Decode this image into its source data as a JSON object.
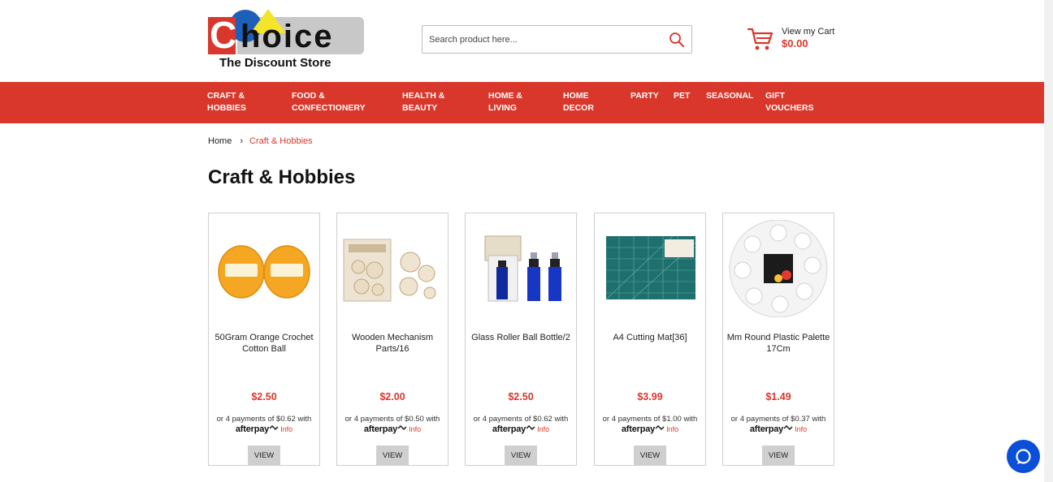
{
  "logo": {
    "wordmark_initial": "C",
    "wordmark_rest": "hoice",
    "tagline": "The Discount Store"
  },
  "search": {
    "placeholder": "Search product here..."
  },
  "cart": {
    "title": "View my Cart",
    "total": "$0.00"
  },
  "nav": [
    {
      "label": "CRAFT &\nHOBBIES"
    },
    {
      "label": "FOOD &\nCONFECTIONERY"
    },
    {
      "label": "HEALTH &\nBEAUTY"
    },
    {
      "label": "HOME &\nLIVING"
    },
    {
      "label": "HOME\nDECOR"
    },
    {
      "label": "PARTY"
    },
    {
      "label": "PET"
    },
    {
      "label": "SEASONAL"
    },
    {
      "label": "GIFT\nVOUCHERS"
    }
  ],
  "breadcrumb": {
    "home": "Home",
    "separator": "›",
    "current": "Craft & Hobbies"
  },
  "page_title": "Craft & Hobbies",
  "products": [
    {
      "name": "50Gram Orange Crochet Cotton Ball",
      "price": "$2.50",
      "installments": "or 4 payments of $0.62 with",
      "afterpay": "afterpay",
      "info": "Info",
      "view": "VIEW"
    },
    {
      "name": "Wooden Mechanism Parts/16",
      "price": "$2.00",
      "installments": "or 4 payments of $0.50 with",
      "afterpay": "afterpay",
      "info": "Info",
      "view": "VIEW"
    },
    {
      "name": "Glass Roller Ball Bottle/2",
      "price": "$2.50",
      "installments": "or 4 payments of $0.62 with",
      "afterpay": "afterpay",
      "info": "Info",
      "view": "VIEW"
    },
    {
      "name": "A4 Cutting Mat[36]",
      "price": "$3.99",
      "installments": "or 4 payments of $1.00 with",
      "afterpay": "afterpay",
      "info": "Info",
      "view": "VIEW"
    },
    {
      "name": "Mm Round Plastic Palette 17Cm",
      "price": "$1.49",
      "installments": "or 4 payments of $0.37 with",
      "afterpay": "afterpay",
      "info": "Info",
      "view": "VIEW"
    }
  ],
  "colors": {
    "brand_red": "#d9372b",
    "chat_blue": "#0b4fd8",
    "button_grey": "#cfcfcf"
  },
  "icons": {
    "search": "search-icon",
    "cart": "cart-icon",
    "chat": "chat-icon",
    "afterpay": "afterpay-icon"
  }
}
